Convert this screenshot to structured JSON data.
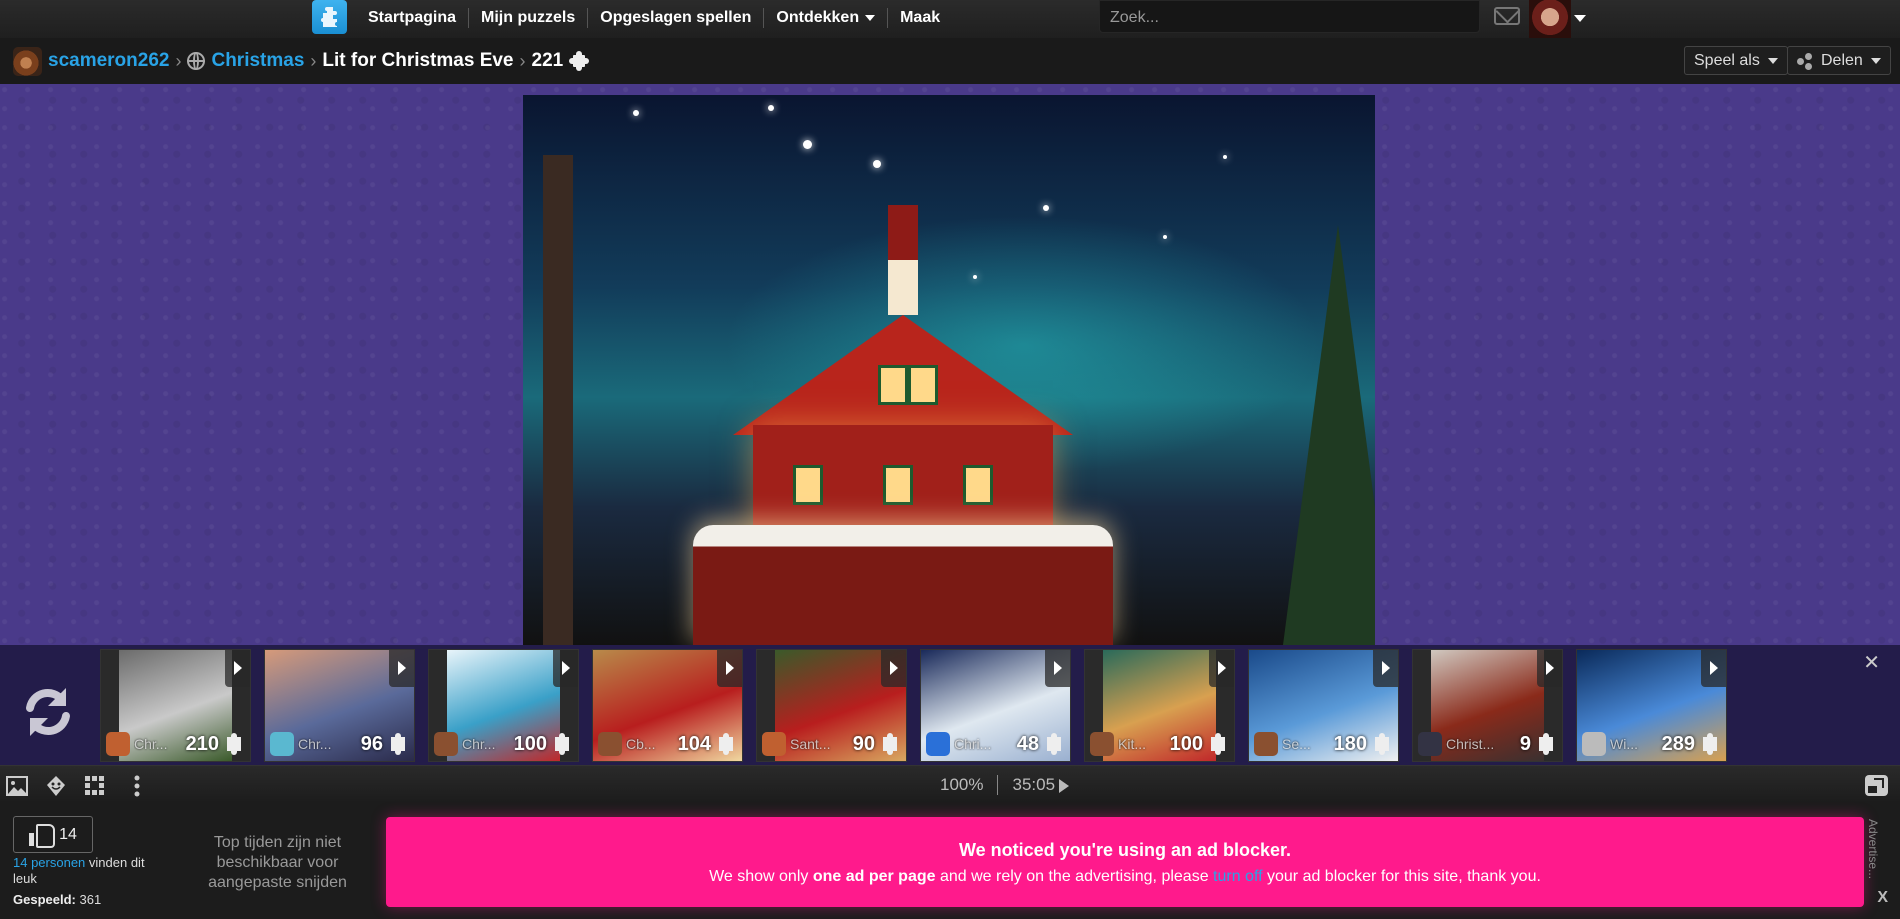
{
  "navbar": {
    "logo_alt": "puzzle-logo",
    "items": [
      {
        "label": "Startpagina"
      },
      {
        "label": "Mijn puzzels"
      },
      {
        "label": "Opgeslagen spellen"
      },
      {
        "label": "Ontdekken",
        "has_dropdown": true
      },
      {
        "label": "Maak"
      }
    ],
    "search_placeholder": "Zoek..."
  },
  "breadcrumb": {
    "user": "scameron262",
    "category": "Christmas",
    "puzzle_title": "Lit for Christmas Eve",
    "piece_count": "221"
  },
  "actions": {
    "play_as": "Speel als",
    "share": "Delen"
  },
  "related_puzzles": [
    {
      "title": "Chr...",
      "pieces": "210"
    },
    {
      "title": "Chr...",
      "pieces": "96"
    },
    {
      "title": "Chr...",
      "pieces": "100"
    },
    {
      "title": "Cb...",
      "pieces": "104"
    },
    {
      "title": "Sant...",
      "pieces": "90"
    },
    {
      "title": "Chri...",
      "pieces": "48"
    },
    {
      "title": "Kit...",
      "pieces": "100"
    },
    {
      "title": "Se...",
      "pieces": "180"
    },
    {
      "title": "Christ...",
      "pieces": "9"
    },
    {
      "title": "Wi...",
      "pieces": "289"
    }
  ],
  "toolbar": {
    "zoom": "100%",
    "timer": "35:05"
  },
  "stats": {
    "likes": "14",
    "likes_link": "14 personen",
    "likes_suffix": "vinden dit leuk",
    "played_label": "Gespeeld:",
    "played_value": "361",
    "top_times": "Top tijden zijn niet beschikbaar voor aangepaste snijden"
  },
  "ad_notice": {
    "title": "We noticed you're using an ad blocker.",
    "text_1": "We show only ",
    "text_bold": "one ad per page",
    "text_2": " and we rely on the advertising, please ",
    "link": "turn off",
    "text_3": " your ad blocker for this site, thank you.",
    "side_label": "Advertise...",
    "close": "X"
  },
  "colors": {
    "accent_link": "#29a3e6",
    "ad_banner": "#ff1a8c",
    "play_background": "#4a3a8a"
  }
}
